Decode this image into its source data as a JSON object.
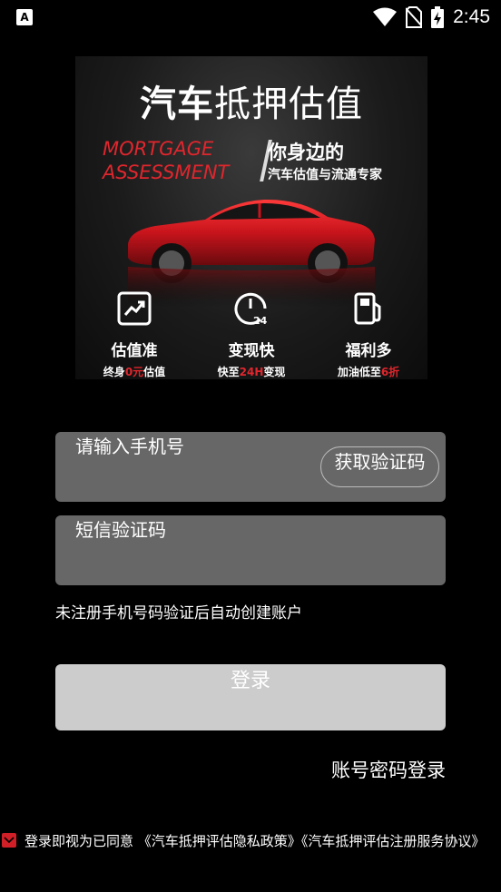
{
  "status_bar": {
    "time": "2:45",
    "icons": [
      "app-notification-icon",
      "wifi-icon",
      "no-sim-icon",
      "battery-charging-icon"
    ]
  },
  "banner": {
    "title_bold": "汽车",
    "title_rest": "抵押估值",
    "english_line1": "MORTGAGE",
    "english_line2": "ASSESSMENT",
    "slogan": "你身边的",
    "subtitle": "汽车估值与流通专家",
    "features": [
      {
        "icon": "chart-trend-icon",
        "label": "估值准",
        "desc_pre": "终身",
        "desc_hl": "0元",
        "desc_post": "估值"
      },
      {
        "icon": "clock-24-icon",
        "label": "变现快",
        "desc_pre": "快至",
        "desc_hl": "24H",
        "desc_post": "变现"
      },
      {
        "icon": "fuel-pump-icon",
        "label": "福利多",
        "desc_pre": "加油低至",
        "desc_hl": "6折",
        "desc_post": ""
      }
    ]
  },
  "form": {
    "phone_placeholder": "请输入手机号",
    "get_code_label": "获取验证码",
    "sms_placeholder": "短信验证码",
    "hint": "未注册手机号码验证后自动创建账户",
    "login_label": "登录",
    "password_login_label": "账号密码登录"
  },
  "agreement": {
    "checked": true,
    "prefix": "登录即视为已同意",
    "privacy_link": "《汽车抵押评估隐私政策》",
    "service_link": "《汽车抵押评估注册服务协议》"
  },
  "colors": {
    "background": "#000000",
    "input_bg": "#676767",
    "login_button_bg": "#cccccc",
    "accent_red": "#e0262d"
  }
}
